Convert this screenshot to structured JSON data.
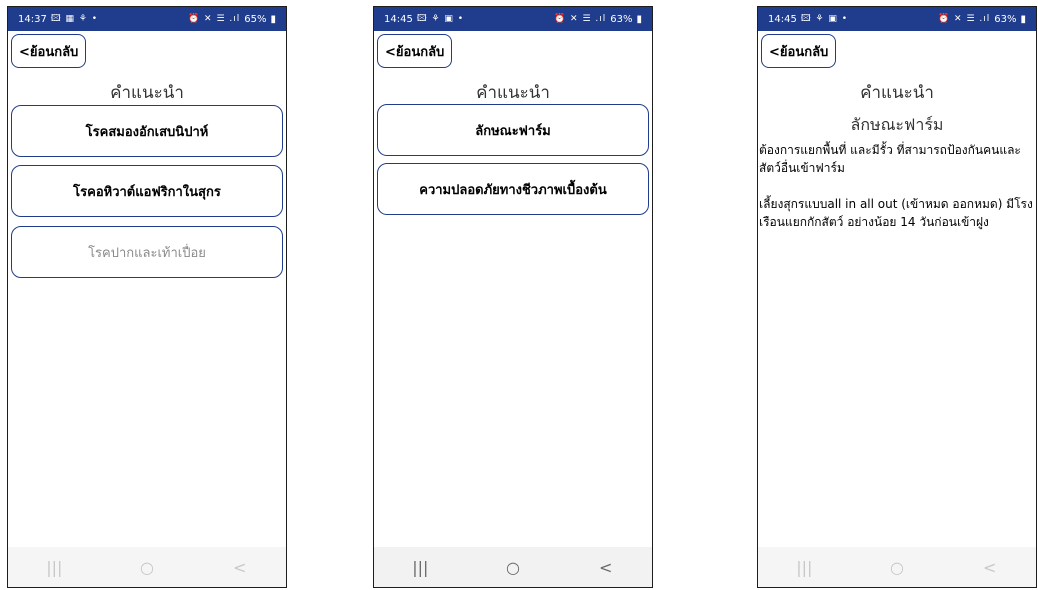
{
  "screen1": {
    "status": {
      "time": "14:37",
      "left_icons": "🖾 ▦ ⚘ •",
      "right_icons": "⏰ ✕ ☰ .ıl",
      "battery": "65%"
    },
    "back_label": "<ย้อนกลับ",
    "title": "คำแนะนำ",
    "buttons": [
      {
        "label": "โรคสมองอักเสบนิปาห์"
      },
      {
        "label": "โรคอหิวาต์แอฟริกาในสุกร"
      },
      {
        "label": "โรคปากและเท้าเปื่อย"
      }
    ]
  },
  "screen2": {
    "status": {
      "time": "14:45",
      "left_icons": "🖾 ⚘ ▣ •",
      "right_icons": "⏰ ✕ ☰ .ıl",
      "battery": "63%"
    },
    "back_label": "<ย้อนกลับ",
    "title": "คำแนะนำ",
    "buttons": [
      {
        "label": "ลักษณะฟาร์ม"
      },
      {
        "label": "ความปลอดภัยทางชีวภาพเบื้องต้น"
      }
    ]
  },
  "screen3": {
    "status": {
      "time": "14:45",
      "left_icons": "🖾 ⚘ ▣ •",
      "right_icons": "⏰ ✕ ☰ .ıl",
      "battery": "63%"
    },
    "back_label": "<ย้อนกลับ",
    "title": "คำแนะนำ",
    "subtitle": "ลักษณะฟาร์ม",
    "paragraphs": [
      "ต้องการแยกพื้นที่ และมีรั้ว ที่สามารถป้องกันคนและสัตว์อื่นเข้าฟาร์ม",
      "เลี้ยงสุกรแบบall in all out (เข้าหมด ออกหมด) มีโรงเรือนแยกกักสัตว์ อย่างน้อย 14 วันก่อนเข้าฝูง"
    ]
  },
  "navbar": {
    "recent": "|||",
    "home": "○",
    "back": "<"
  }
}
